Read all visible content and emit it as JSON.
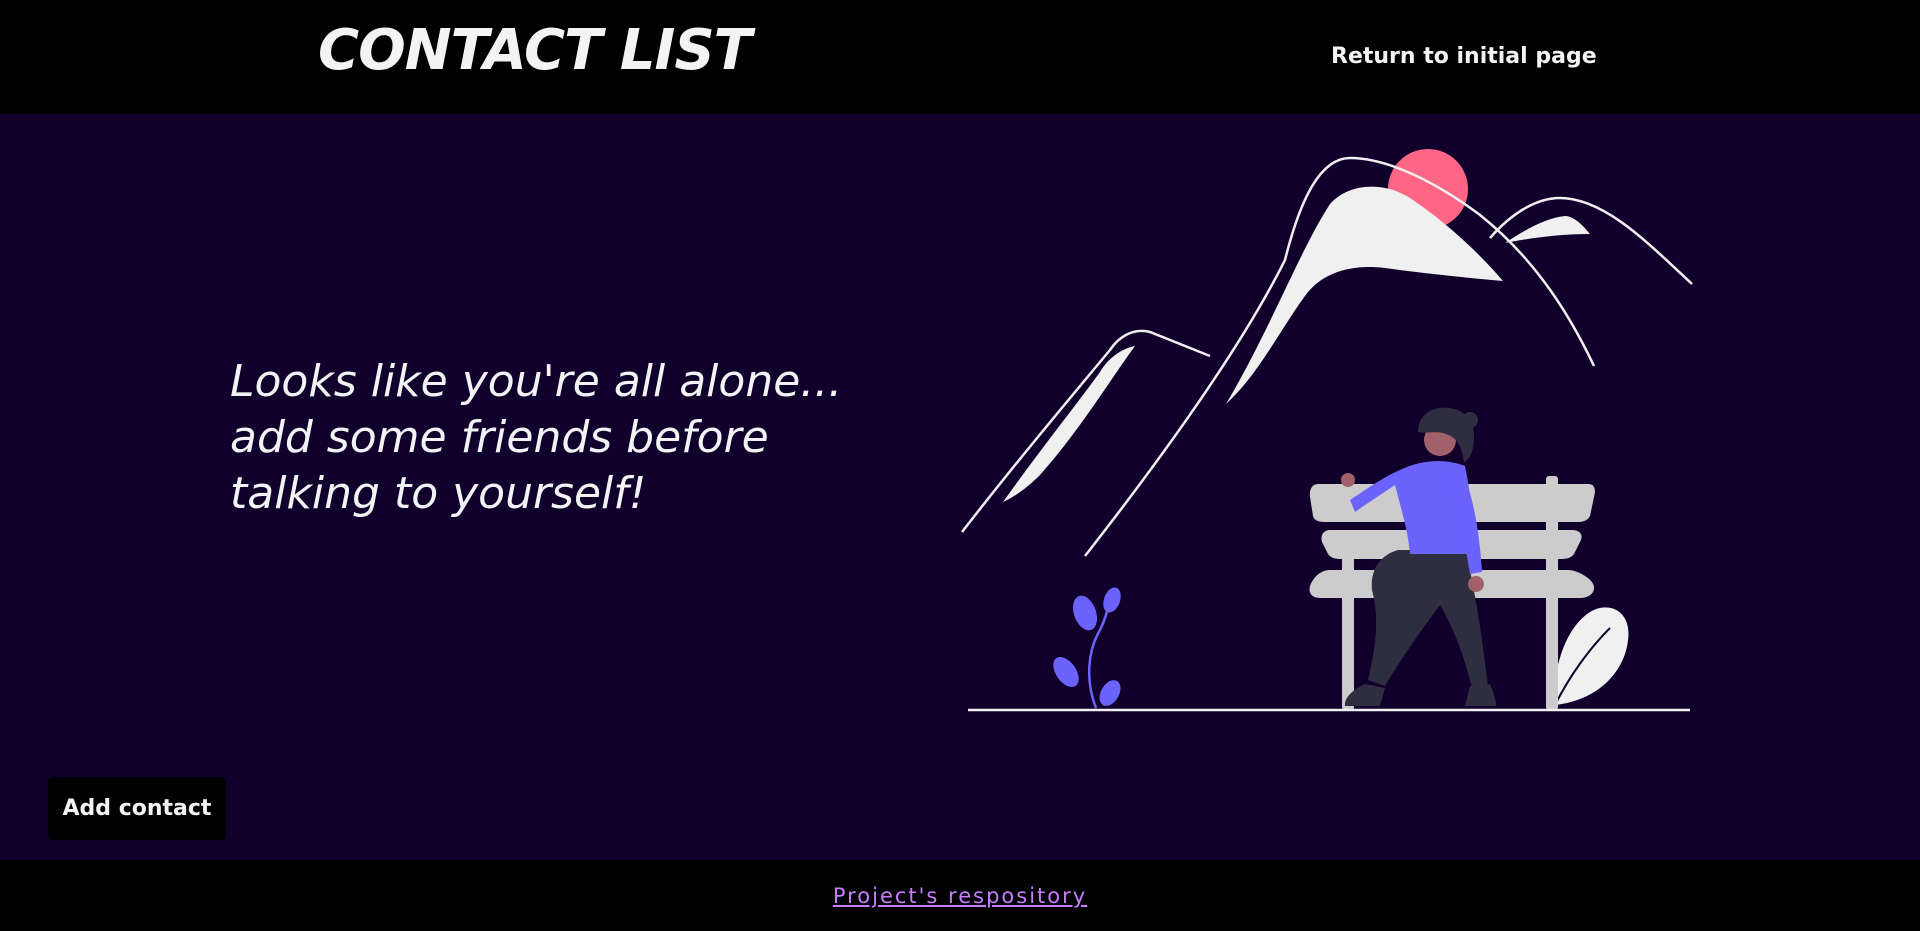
{
  "header": {
    "title": "CONTACT LIST",
    "nav_link": "Return to initial page"
  },
  "main": {
    "empty_message": [
      "Looks like you're all alone...",
      "add some friends before",
      "talking to yourself!"
    ],
    "add_button": "Add contact"
  },
  "footer": {
    "repo_link": "Project's respository"
  },
  "colors": {
    "background": "#10002b",
    "header_footer": "#000000",
    "text": "#f1f3f5",
    "link": "#c77dff",
    "sun": "#ff6584",
    "accent": "#6c63ff",
    "bench": "#cccccc"
  },
  "illustration": {
    "name": "alone-on-bench-illustration"
  }
}
